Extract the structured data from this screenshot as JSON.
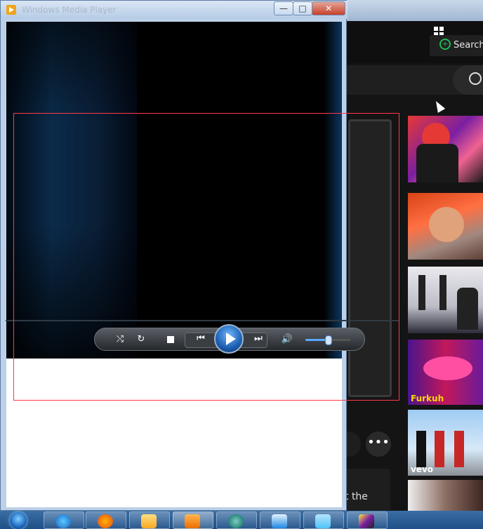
{
  "background_app": {
    "search_label": "Search",
    "more_label": "•••",
    "caption_fragment": "t the",
    "thumbnails": [
      {
        "name": "thumb-1",
        "title": ""
      },
      {
        "name": "thumb-2",
        "title": ""
      },
      {
        "name": "thumb-3",
        "title": ""
      },
      {
        "name": "thumb-4",
        "title": "Furkuh"
      },
      {
        "name": "thumb-5",
        "title": "vevo"
      },
      {
        "name": "thumb-6",
        "title": ""
      }
    ]
  },
  "wmp": {
    "window_title": "Windows Media Player",
    "minimize_label": "—",
    "maximize_label": "□",
    "close_label": "✕",
    "controls": {
      "shuffle_glyph": "⤭",
      "repeat_glyph": "↻",
      "previous_glyph": "⏮",
      "next_glyph": "⏭",
      "volume_glyph": "🔊",
      "volume_level": 0.5
    }
  },
  "taskbar": {
    "pinned": [
      "start",
      "internet-explorer",
      "firefox",
      "file-explorer",
      "media-player",
      "app-green",
      "app-blue-1",
      "app-blue-2",
      "app-film"
    ]
  },
  "colors": {
    "highlight_frame": "#ff3a4a",
    "taskbar": "#2a5a91",
    "accent_green": "#1db954"
  }
}
